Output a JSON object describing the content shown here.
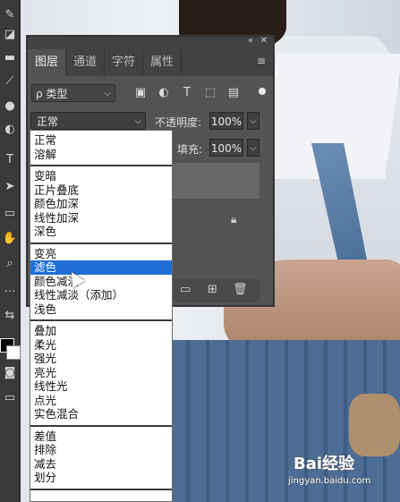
{
  "panel": {
    "tabs": [
      {
        "label": "图层"
      },
      {
        "label": "通道"
      },
      {
        "label": "字符"
      },
      {
        "label": "属性"
      }
    ],
    "collapse_label": "«",
    "close_label": "✕",
    "filter": {
      "label": "ρ 类型",
      "chevron": "⌵"
    },
    "blend_mode": {
      "value": "正常",
      "chevron": "⌵"
    },
    "opacity": {
      "label": "不透明度:",
      "value": "100%"
    },
    "fill": {
      "label": "填充:",
      "value": "100%"
    }
  },
  "dropdown": {
    "groups": [
      [
        "正常",
        "溶解"
      ],
      [
        "变暗",
        "正片叠底",
        "颜色加深",
        "线性加深",
        "深色"
      ],
      [
        "变亮",
        "滤色",
        "颜色减淡",
        "线性减淡（添加）",
        "浅色"
      ],
      [
        "叠加",
        "柔光",
        "强光",
        "亮光",
        "线性光",
        "点光",
        "实色混合"
      ],
      [
        "差值",
        "排除",
        "减去",
        "划分"
      ]
    ],
    "selected": "滤色"
  },
  "watermark": {
    "logo": "Bai经验",
    "url": "jingyan.baidu.com"
  },
  "icons": [
    "pen-icon",
    "eraser-icon",
    "gradient-icon",
    "brush-icon",
    "blur-icon",
    "dodge-icon",
    "pen-tool-icon",
    "type-icon",
    "path-select-icon",
    "shape-icon",
    "hand-icon",
    "zoom-icon",
    "more-icon",
    "swap-icon"
  ]
}
